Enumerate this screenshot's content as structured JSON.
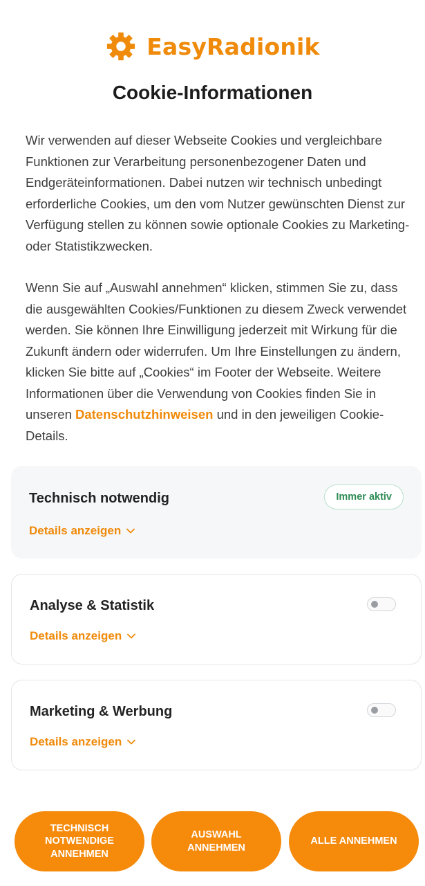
{
  "brand": {
    "name": "EasyRadionik",
    "accent": "#f08a0a",
    "icon": "gear-icon"
  },
  "title": "Cookie-Informationen",
  "intro": {
    "paragraph1": "Wir verwenden auf dieser Webseite Cookies und vergleichbare Funktionen zur Verarbeitung personenbezogener Daten und Endgeräteinformationen. Dabei nutzen wir technisch unbedingt erforderliche Cookies, um den vom Nutzer gewünschten Dienst zur Verfügung stellen zu können sowie optionale Cookies zu Marketing- oder Statistikzwecken.",
    "paragraph2_before": "Wenn Sie auf „Auswahl annehmen“ klicken, stimmen Sie zu, dass die ausgewählten Cookies/Funktionen zu diesem Zweck verwendet werden. Sie können Ihre Einwilligung jederzeit mit Wirkung für die Zukunft ändern oder widerrufen. Um Ihre Einstellungen zu ändern, klicken Sie bitte auf „Cookies“ im Footer der Webseite. Weitere Informationen über die Verwendung von Cookies finden Sie in unseren ",
    "paragraph2_link": "Datenschutzhinweisen",
    "paragraph2_after": " und in den jeweiligen Cookie-Details."
  },
  "categories": [
    {
      "title": "Technisch notwendig",
      "details": "Details anzeigen",
      "badge": "Immer aktiv",
      "badge_color": "#2f8b55"
    },
    {
      "title": "Analyse & Statistik",
      "details": "Details anzeigen",
      "toggle_on": false
    },
    {
      "title": "Marketing & Werbung",
      "details": "Details anzeigen",
      "toggle_on": false
    }
  ],
  "buttons": {
    "necessary": "TECHNISCH NOTWENDIGE ANNEHMEN",
    "selection": "AUSWAHL ANNEHMEN",
    "all": "ALLE ANNEHMEN",
    "color": "#f58a0b"
  }
}
